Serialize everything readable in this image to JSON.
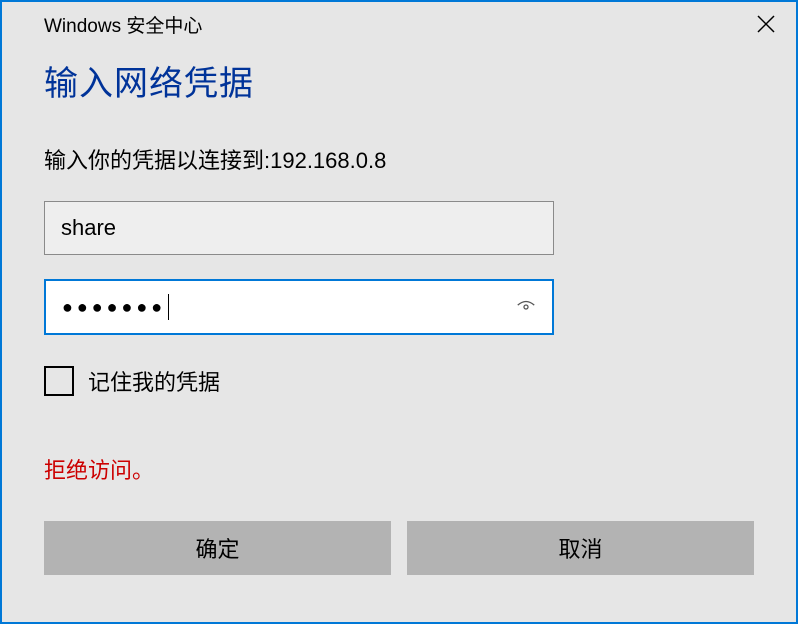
{
  "titlebar": {
    "title": "Windows 安全中心"
  },
  "dialog": {
    "heading": "输入网络凭据",
    "subheading": "输入你的凭据以连接到:192.168.0.8",
    "username_value": "share",
    "password_masked": "●●●●●●●",
    "remember_label": "记住我的凭据",
    "error_message": "拒绝访问。",
    "ok_label": "确定",
    "cancel_label": "取消"
  }
}
